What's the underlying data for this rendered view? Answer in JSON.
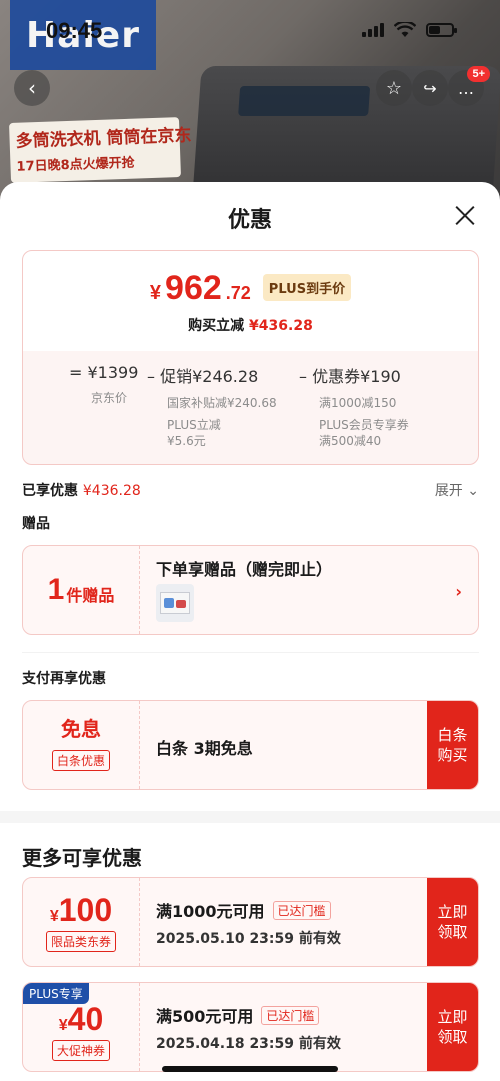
{
  "status_bar": {
    "time": "09:45"
  },
  "background": {
    "logo": "Haier",
    "banner_line1": "多筒洗衣机 筒筒在京东",
    "banner_line2": "17日晚8点火爆开抢",
    "cart_badge": "5+",
    "icons": [
      "back-icon",
      "star-icon",
      "share-icon",
      "more-icon"
    ]
  },
  "sheet": {
    "title": "优惠",
    "price": {
      "yen": "¥",
      "integer": "962",
      "decimal": ".72",
      "plus_tag": "PLUS到手价",
      "instant_label": "购买立减",
      "instant_value": "¥436.28"
    },
    "breakdown": {
      "jd": {
        "main": "= ¥1399",
        "sub": "京东价"
      },
      "promo": {
        "main": "– 促销¥246.28",
        "sub1": "国家补贴减¥240.68",
        "sub2": "PLUS立减",
        "sub3": "¥5.6元"
      },
      "coupon": {
        "main": "– 优惠券¥190",
        "sub1": "满1000减150",
        "sub2": "PLUS会员专享券",
        "sub3": "满500减40"
      }
    },
    "enjoyed": {
      "label": "已享优惠",
      "value": "¥436.28",
      "expand": "展开"
    },
    "gifts": {
      "section": "赠品",
      "count": "1",
      "unit": "件赠品",
      "title": "下单享赠品（赠完即止）"
    },
    "pay": {
      "section": "支付再享优惠",
      "main": "免息",
      "tag": "白条优惠",
      "title": "白条 3期免息",
      "button": "白条\n购买"
    },
    "more": {
      "title": "更多可享优惠",
      "coupons": [
        {
          "yen": "¥",
          "amount": "100",
          "tag": "限品类东券",
          "cond": "满1000元可用",
          "reached": "已达门槛",
          "expiry": "2025.05.10 23:59 前有效",
          "button": "立即\n领取",
          "plus": ""
        },
        {
          "yen": "¥",
          "amount": "40",
          "tag": "大促神券",
          "cond": "满500元可用",
          "reached": "已达门槛",
          "expiry": "2025.04.18 23:59 前有效",
          "button": "立即\n领取",
          "plus": "PLUS专享"
        }
      ]
    }
  },
  "colors": {
    "accent": "#e1251b",
    "plus_blue": "#1f4fa8",
    "card_bg": "#fff7f6"
  }
}
